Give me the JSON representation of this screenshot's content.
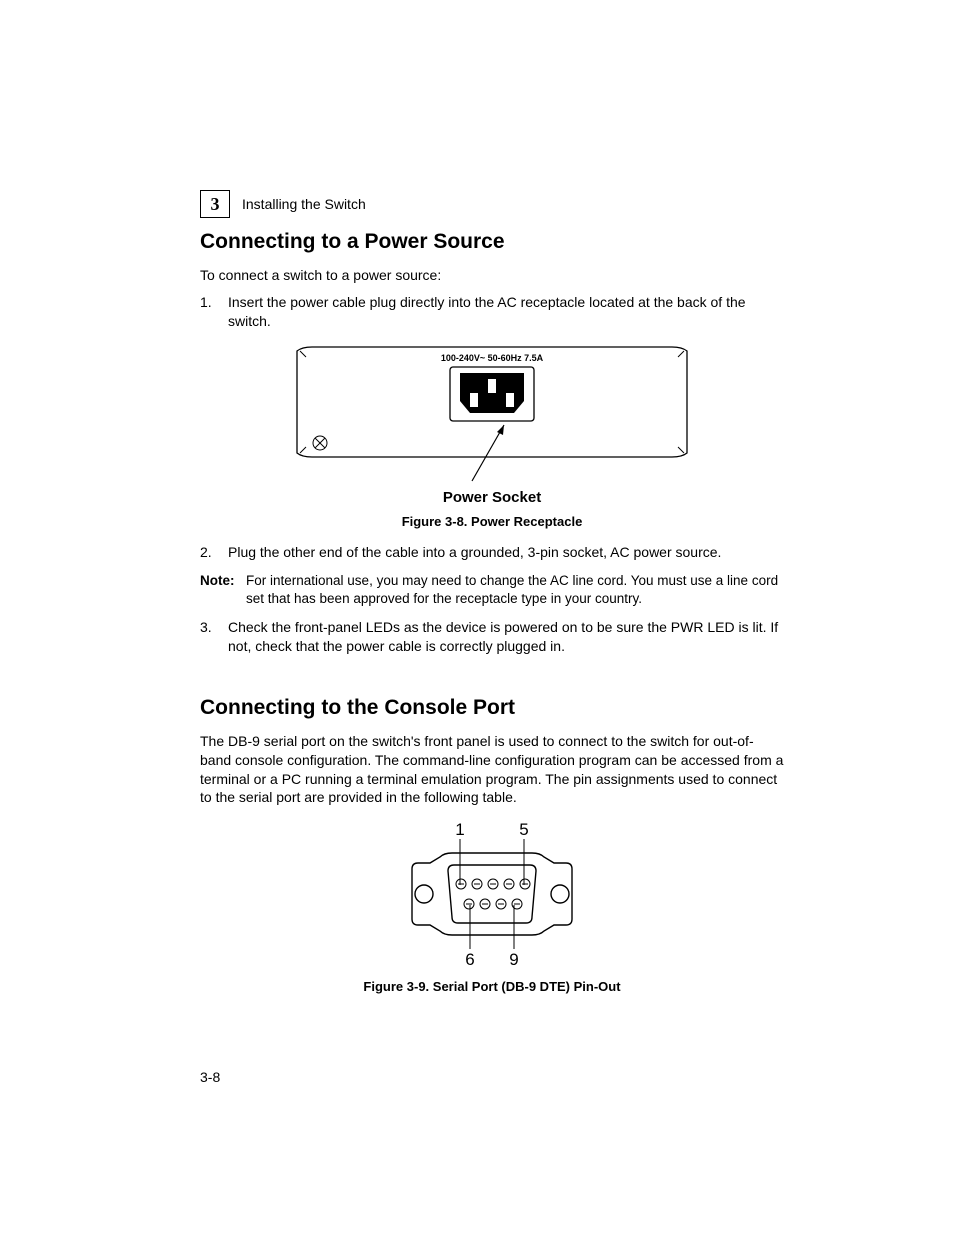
{
  "header": {
    "chapter_number": "3",
    "running_title": "Installing the Switch"
  },
  "section1": {
    "title": "Connecting to a Power Source",
    "intro": "To connect a switch to a power source:",
    "step1_num": "1.",
    "step1_text": "Insert the power cable plug directly into the AC receptacle located at the back of the switch.",
    "figure_rating": "100-240V~  50-60Hz 7.5A",
    "figure_sublabel": "Power Socket",
    "figure_caption": "Figure 3-8.  Power Receptacle",
    "step2_num": "2.",
    "step2_text": "Plug the other end of the cable into a grounded, 3-pin socket, AC power source.",
    "note_label": "Note:",
    "note_text": "For international use, you may need to change the AC line cord. You must use a line cord set that has been approved for the receptacle type in your country.",
    "step3_num": "3.",
    "step3_text": "Check the front-panel LEDs as the device is powered on to be sure the PWR LED is lit. If not, check that the power cable is correctly plugged in."
  },
  "section2": {
    "title": "Connecting to the Console Port",
    "intro": "The DB-9 serial port on the switch's front panel is used to connect to the switch for out-of-band console configuration. The command-line configuration program can be accessed from a terminal or a PC running a terminal emulation program. The pin assignments used to connect to the serial port are provided in the following table.",
    "pin1": "1",
    "pin5": "5",
    "pin6": "6",
    "pin9": "9",
    "figure_caption": "Figure 3-9.  Serial Port (DB-9 DTE) Pin-Out"
  },
  "footer": {
    "page_number": "3-8"
  }
}
